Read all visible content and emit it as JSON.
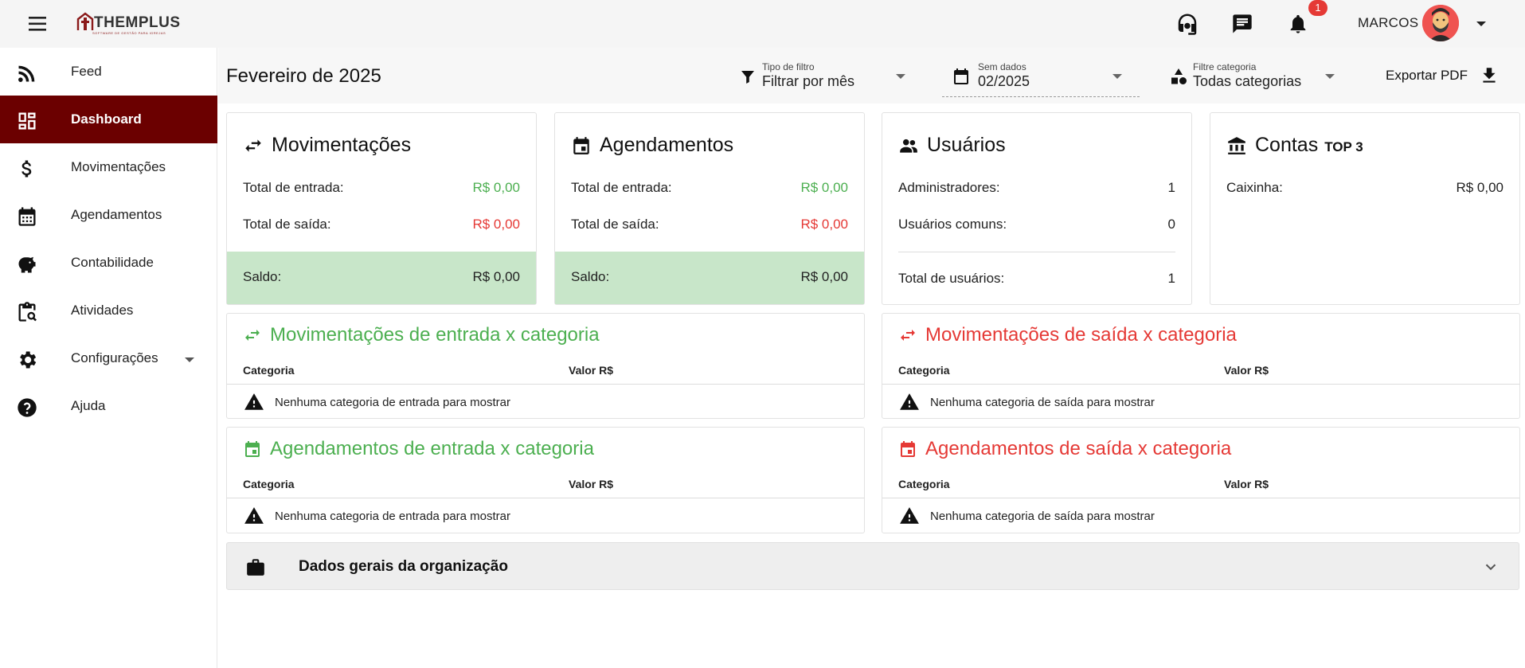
{
  "app": {
    "logo_text": "THEMPLUS",
    "logo_subtitle": "SOFTWARE DE GESTÃO PARA IGREJAS",
    "notification_count": "1",
    "user_name": "MARCOS"
  },
  "sidebar": {
    "items": [
      {
        "label": "Feed",
        "icon": "rss-icon"
      },
      {
        "label": "Dashboard",
        "icon": "dashboard-icon",
        "active": true
      },
      {
        "label": "Movimentações",
        "icon": "dollar-icon"
      },
      {
        "label": "Agendamentos",
        "icon": "calendar-icon"
      },
      {
        "label": "Contabilidade",
        "icon": "piggy-bank-icon"
      },
      {
        "label": "Atividades",
        "icon": "clipboard-search-icon"
      },
      {
        "label": "Configurações",
        "icon": "gear-icon",
        "has_submenu": true
      },
      {
        "label": "Ajuda",
        "icon": "help-icon"
      }
    ]
  },
  "header": {
    "title": "Fevereiro de 2025",
    "filter_type": {
      "label": "Tipo de filtro",
      "value": "Filtrar por mês"
    },
    "date_filter": {
      "label": "Sem dados",
      "value": "02/2025"
    },
    "category_filter": {
      "label": "Filtre categoria",
      "value": "Todas categorias"
    },
    "export_label": "Exportar PDF"
  },
  "cards": {
    "movimentacoes": {
      "title": "Movimentações",
      "entrada_label": "Total de entrada:",
      "entrada_value": "R$ 0,00",
      "saida_label": "Total de saída:",
      "saida_value": "R$ 0,00",
      "saldo_label": "Saldo:",
      "saldo_value": "R$ 0,00"
    },
    "agendamentos": {
      "title": "Agendamentos",
      "entrada_label": "Total de entrada:",
      "entrada_value": "R$ 0,00",
      "saida_label": "Total de saída:",
      "saida_value": "R$ 0,00",
      "saldo_label": "Saldo:",
      "saldo_value": "R$ 0,00"
    },
    "usuarios": {
      "title": "Usuários",
      "admins_label": "Administradores:",
      "admins_value": "1",
      "comuns_label": "Usuários comuns:",
      "comuns_value": "0",
      "total_label": "Total de usuários:",
      "total_value": "1"
    },
    "contas": {
      "title": "Contas",
      "badge": "TOP 3",
      "items": [
        {
          "label": "Caixinha:",
          "value": "R$ 0,00"
        }
      ]
    }
  },
  "panels": {
    "mov_entrada": {
      "title": "Movimentações de entrada x categoria",
      "col1": "Categoria",
      "col2": "Valor R$",
      "empty": "Nenhuma categoria de entrada para mostrar"
    },
    "mov_saida": {
      "title": "Movimentações de saída x categoria",
      "col1": "Categoria",
      "col2": "Valor R$",
      "empty": "Nenhuma categoria de saída para mostrar"
    },
    "ag_entrada": {
      "title": "Agendamentos de entrada x categoria",
      "col1": "Categoria",
      "col2": "Valor R$",
      "empty": "Nenhuma categoria de entrada para mostrar"
    },
    "ag_saida": {
      "title": "Agendamentos de saída x categoria",
      "col1": "Categoria",
      "col2": "Valor R$",
      "empty": "Nenhuma categoria de saída para mostrar"
    }
  },
  "organization": {
    "label": "Dados gerais da organização"
  },
  "colors": {
    "brand": "#6b0000",
    "positive": "#4caf50",
    "negative": "#e53935",
    "saldo_bg": "#c8e6c9",
    "badge": "#e53935"
  }
}
